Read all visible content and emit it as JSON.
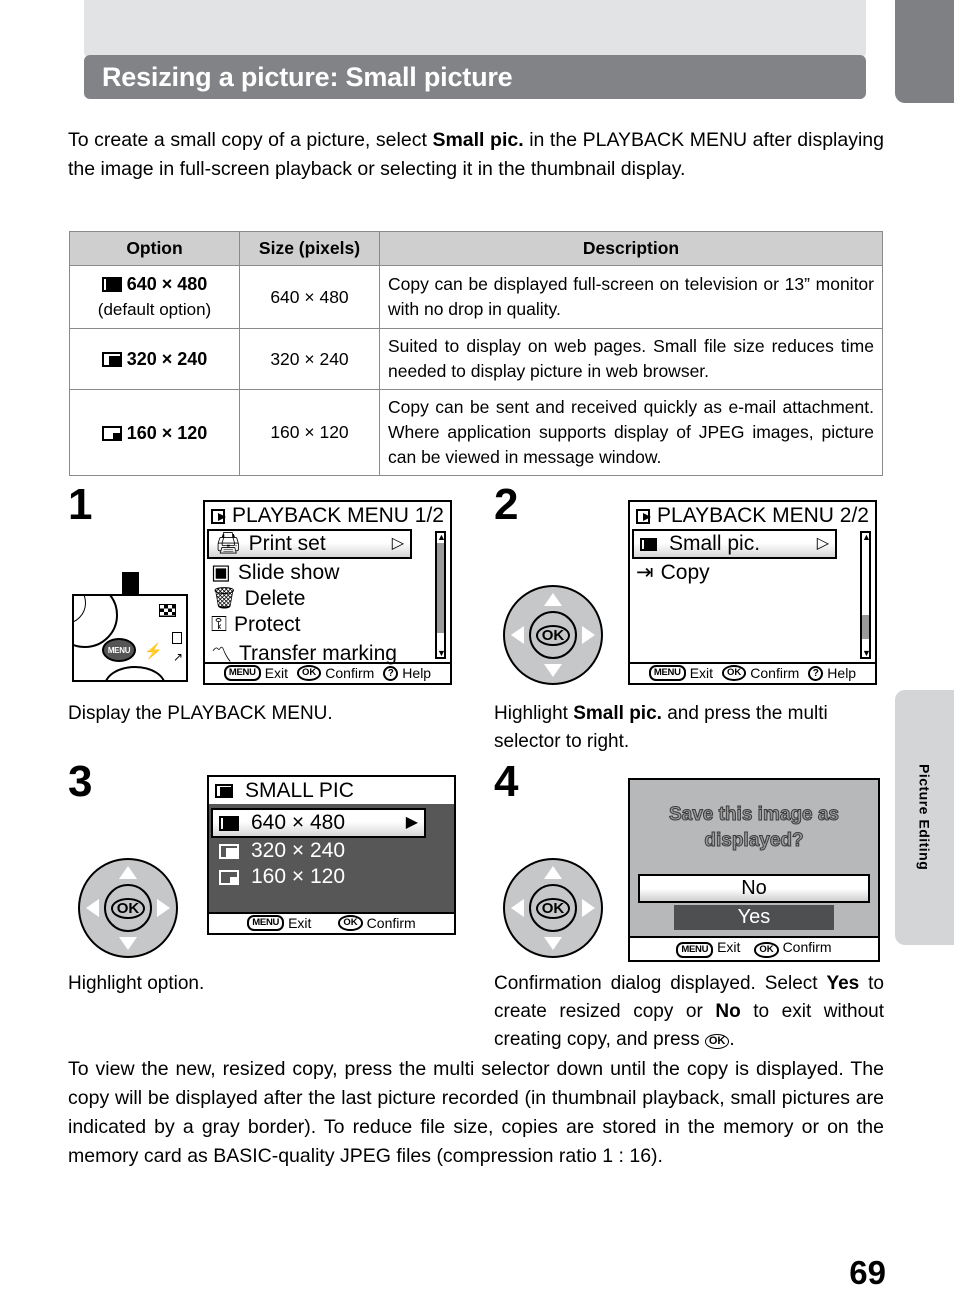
{
  "page": {
    "title": "Resizing a picture: Small picture",
    "number": "69",
    "side_tab": "Picture Editing"
  },
  "intro": {
    "part1": "To create a small copy of a picture, select ",
    "bold1": "Small pic.",
    "part2": " in the PLAYBACK MENU after displaying the image in full-screen playback or selecting it in the thumbnail display."
  },
  "table": {
    "headers": [
      "Option",
      "Size (pixels)",
      "Description"
    ],
    "rows": [
      {
        "icon": "frame-640-icon",
        "option": "640 × 480",
        "option_sub": "(default option)",
        "size": "640 × 480",
        "description": "Copy can be displayed full-screen on television or 13” monitor with no drop in quality."
      },
      {
        "icon": "frame-320-icon",
        "option": "320 × 240",
        "option_sub": "",
        "size": "320 × 240",
        "description": "Suited to display on web pages. Small file size reduces time needed to display picture in web browser."
      },
      {
        "icon": "frame-160-icon",
        "option": "160 × 120",
        "option_sub": "",
        "size": "160 × 120",
        "description": "Copy can be sent and received quickly as e-mail attachment. Where application supports display of JPEG images, picture can be viewed in message window."
      }
    ]
  },
  "steps": [
    {
      "number": "1",
      "caption": "Display the PLAYBACK MENU.",
      "screen": {
        "title": "PLAYBACK MENU 1/2",
        "items": [
          "Print set",
          "Slide show",
          "Delete",
          "Protect",
          "Transfer marking"
        ],
        "selected": "Print set",
        "footer": [
          {
            "key": "MENU",
            "label": "Exit"
          },
          {
            "key": "OK",
            "label": "Confirm"
          },
          {
            "key": "?",
            "label": "Help"
          }
        ]
      }
    },
    {
      "number": "2",
      "caption_part1": "Highlight ",
      "caption_bold": "Small pic.",
      "caption_part2": " and press the multi selector to right.",
      "screen": {
        "title": "PLAYBACK MENU 2/2",
        "items": [
          "Small pic.",
          "Copy"
        ],
        "selected": "Small pic.",
        "footer": [
          {
            "key": "MENU",
            "label": "Exit"
          },
          {
            "key": "OK",
            "label": "Confirm"
          },
          {
            "key": "?",
            "label": "Help"
          }
        ]
      }
    },
    {
      "number": "3",
      "caption": "Highlight option.",
      "screen": {
        "title": "SMALL PIC",
        "items": [
          "640 × 480",
          "320 × 240",
          "160 × 120"
        ],
        "selected": "640 × 480",
        "footer": [
          {
            "key": "MENU",
            "label": "Exit"
          },
          {
            "key": "OK",
            "label": "Confirm"
          }
        ]
      }
    },
    {
      "number": "4",
      "caption_part1": "Confirmation dialog displayed. Select ",
      "caption_bold1": "Yes",
      "caption_mid": " to create resized copy or ",
      "caption_bold2": "No",
      "caption_part2": " to exit without creating copy, and press ",
      "caption_end": ".",
      "dialog": {
        "message_line1": "Save this image as",
        "message_line2": "displayed?",
        "option_no": "No",
        "option_yes": "Yes",
        "selected": "No",
        "footer": [
          {
            "key": "MENU",
            "label": "Exit"
          },
          {
            "key": "OK",
            "label": "Confirm"
          }
        ]
      }
    }
  ],
  "outro": "To view the new, resized copy, press the multi selector down until the copy is displayed. The copy will be displayed after the last picture recorded (in thumbnail playback, small pictures are indicated by a gray border). To reduce file size, copies are stored in the memory or on the memory card as BASIC-quality JPEG files (compression ratio 1 : 16).",
  "keys": {
    "menu": "MENU",
    "ok": "OK",
    "help": "?"
  },
  "colors": {
    "title_bar": "#828387",
    "top_block": "#e2e3e5",
    "right_tab": "#7f8083",
    "side_tab": "#d4d5d7",
    "table_header": "#cfcfcf",
    "lcd_dark": "#575757",
    "dialog_bg": "#b7b8ba"
  }
}
